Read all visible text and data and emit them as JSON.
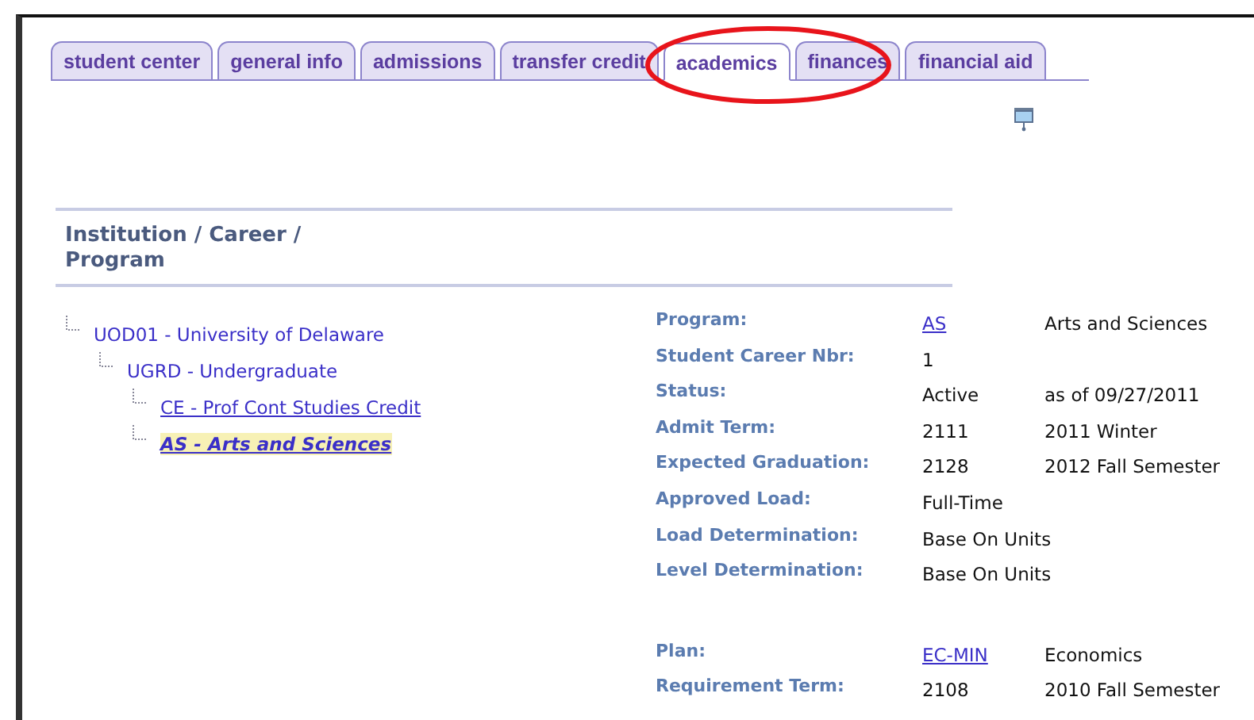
{
  "tabs": [
    {
      "label": "student center",
      "selected": false
    },
    {
      "label": "general info",
      "selected": false
    },
    {
      "label": "admissions",
      "selected": false
    },
    {
      "label": "transfer credit",
      "selected": false
    },
    {
      "label": "academics",
      "selected": true
    },
    {
      "label": "finances",
      "selected": false
    },
    {
      "label": "financial aid",
      "selected": false
    }
  ],
  "annotation": {
    "kind": "ellipse",
    "color": "#e8141b"
  },
  "section_title": "Institution / Career / Program",
  "tree": [
    {
      "label": "UOD01 - University of Delaware",
      "link": false,
      "selected": false,
      "children": [
        {
          "label": "UGRD - Undergraduate",
          "link": false,
          "selected": false,
          "children": [
            {
              "label": "CE - Prof Cont Studies Credit",
              "link": true,
              "selected": false
            },
            {
              "label": "AS - Arts and Sciences",
              "link": true,
              "selected": true
            }
          ]
        }
      ]
    }
  ],
  "details": [
    {
      "label": "Program:",
      "value": "AS",
      "value_link": true,
      "description": "Arts and Sciences"
    },
    {
      "label": "Student Career Nbr:",
      "value": "1",
      "value_link": false
    },
    {
      "label": "Status:",
      "value": "Active",
      "value_link": false,
      "description": "as of 09/27/2011"
    },
    {
      "label": "Admit Term:",
      "value": "2111",
      "value_link": false,
      "description": "2011 Winter"
    },
    {
      "label": "Expected Graduation:",
      "value": "2128",
      "value_link": false,
      "description": "2012 Fall Semester"
    },
    {
      "label": "Approved Load:",
      "value": "Full-Time",
      "value_link": false
    },
    {
      "label": "Load Determination:",
      "value": "Base On Units",
      "value_link": false
    },
    {
      "label": "Level Determination:",
      "value": "Base On Units",
      "value_link": false
    }
  ],
  "plan": [
    {
      "label": "Plan:",
      "value": "EC-MIN",
      "value_link": true,
      "description": "Economics"
    },
    {
      "label": "Requirement Term:",
      "value": "2108",
      "value_link": false,
      "description": "2010 Fall Semester"
    }
  ]
}
